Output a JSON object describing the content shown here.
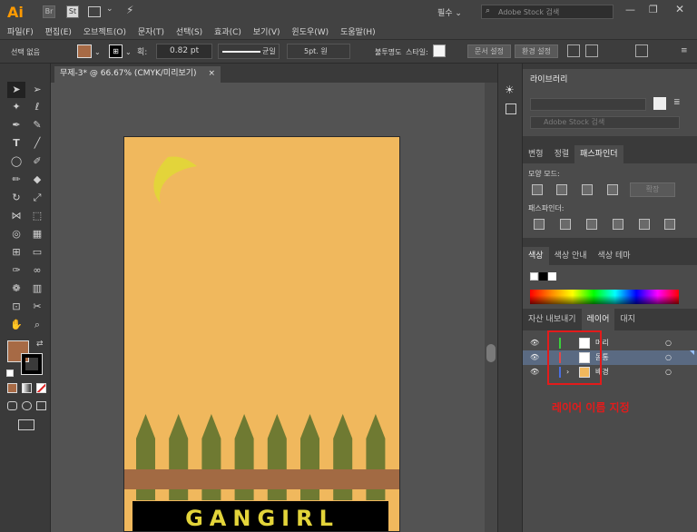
{
  "app": {
    "logo": "Ai",
    "br": "Br",
    "st": "St"
  },
  "topright": {
    "workspace": "필수",
    "search_placeholder": "Adobe Stock 검색"
  },
  "menu": [
    "파일(F)",
    "편집(E)",
    "오브젝트(O)",
    "문자(T)",
    "선택(S)",
    "효과(C)",
    "보기(V)",
    "윈도우(W)",
    "도움말(H)"
  ],
  "control": {
    "selection_label": "선택 없음",
    "stroke_weight": "0.82 pt",
    "stroke_profile": "균일",
    "brush": "5pt. 원",
    "opacity_label": "불투명도",
    "style_label": "스타일:",
    "doc_setup": "문서 설정",
    "preferences": "환경 설정"
  },
  "document": {
    "tab_title": "무제-3* @ 66.67% (CMYK/미리보기)",
    "close": "×"
  },
  "artwork": {
    "title_text": "GANGIRL",
    "colors": {
      "background": "#f0b85d",
      "moon": "#e3d43a",
      "fence": "#6f7a32",
      "rail": "#a26a43",
      "titlebar": "#000000",
      "title": "#e3d43a"
    },
    "picket_count": 8
  },
  "panels": {
    "library": {
      "title": "라이브러리",
      "search_placeholder": "Adobe Stock 검색"
    },
    "pathfinder": {
      "tabs": [
        "변형",
        "정렬",
        "패스파인더"
      ],
      "shape_modes": "모양 모드:",
      "expand": "확장",
      "pathfinders": "패스파인더:"
    },
    "color": {
      "tabs": [
        "색상",
        "색상 안내",
        "색상 테마"
      ]
    },
    "layers": {
      "tabs": [
        "자산 내보내기",
        "레이어",
        "대지"
      ],
      "rows": [
        {
          "name": "머리",
          "color": "#3ad13a"
        },
        {
          "name": "몸통",
          "color": "#e34848"
        },
        {
          "name": "배경",
          "color": "#4a6fe0"
        }
      ]
    }
  },
  "annotation": {
    "text": "레이어 이름 지정",
    "color": "#e31b1b"
  },
  "swatches": {
    "fill": "#a76a45",
    "stroke": "#000000",
    "accent": "#ff9a00"
  }
}
